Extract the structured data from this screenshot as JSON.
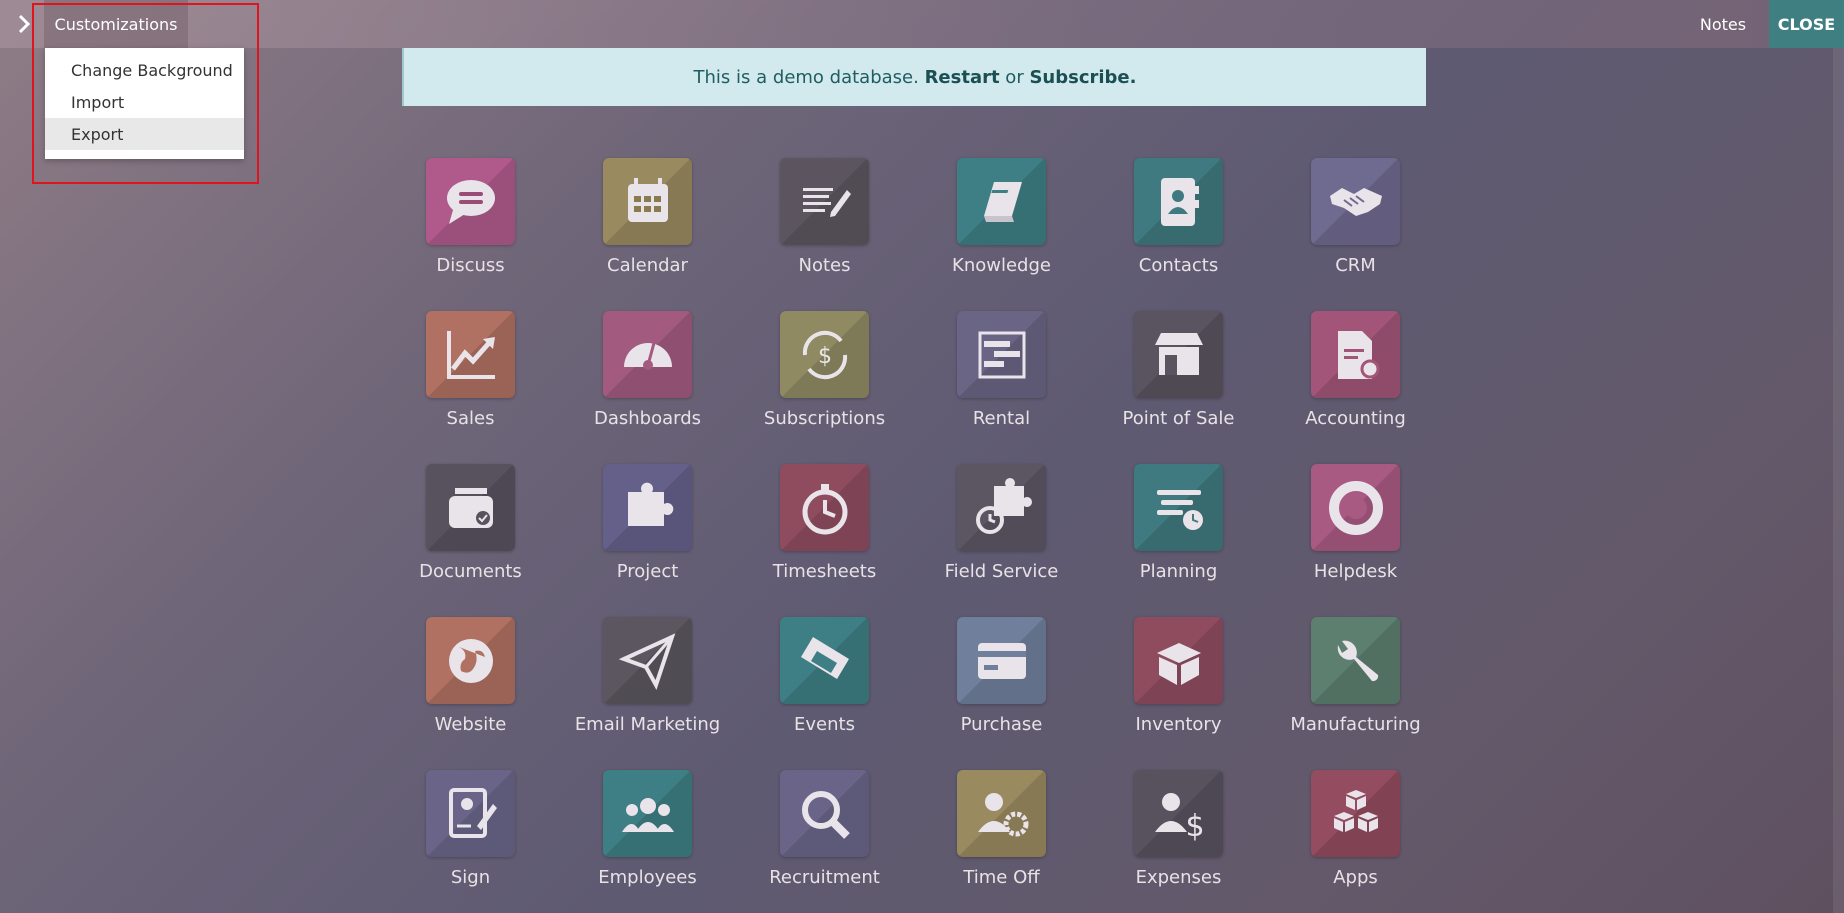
{
  "topbar": {
    "customizations_label": "Customizations",
    "notes_label": "Notes",
    "close_label": "CLOSE"
  },
  "dropdown": {
    "items": [
      {
        "label": "Change Background"
      },
      {
        "label": "Import"
      },
      {
        "label": "Export"
      }
    ]
  },
  "banner": {
    "prefix": "This is a demo database. ",
    "restart": "Restart",
    "middle": " or ",
    "subscribe": "Subscribe."
  },
  "apps": [
    {
      "label": "Discuss",
      "color": "#b05a8c",
      "icon": "chat-bubble-icon"
    },
    {
      "label": "Calendar",
      "color": "#9a8a60",
      "icon": "calendar-icon"
    },
    {
      "label": "Notes",
      "color": "#5c5560",
      "icon": "notes-icon"
    },
    {
      "label": "Knowledge",
      "color": "#3e7f85",
      "icon": "book-icon"
    },
    {
      "label": "Contacts",
      "color": "#3f7a80",
      "icon": "address-book-icon"
    },
    {
      "label": "CRM",
      "color": "#6f6a8f",
      "icon": "handshake-icon"
    },
    {
      "label": "Sales",
      "color": "#b07062",
      "icon": "trend-chart-icon"
    },
    {
      "label": "Dashboards",
      "color": "#a35a7f",
      "icon": "gauge-icon"
    },
    {
      "label": "Subscriptions",
      "color": "#8f8a62",
      "icon": "recurring-dollar-icon"
    },
    {
      "label": "Rental",
      "color": "#6a6585",
      "icon": "gantt-icon"
    },
    {
      "label": "Point of Sale",
      "color": "#5a5360",
      "icon": "shop-icon"
    },
    {
      "label": "Accounting",
      "color": "#a25578",
      "icon": "invoice-gear-icon"
    },
    {
      "label": "Documents",
      "color": "#58525e",
      "icon": "inbox-check-icon"
    },
    {
      "label": "Project",
      "color": "#65608a",
      "icon": "puzzle-icon"
    },
    {
      "label": "Timesheets",
      "color": "#8f4c5f",
      "icon": "stopwatch-icon"
    },
    {
      "label": "Field Service",
      "color": "#5c5663",
      "icon": "puzzle-clock-icon"
    },
    {
      "label": "Planning",
      "color": "#3f7a80",
      "icon": "planning-icon"
    },
    {
      "label": "Helpdesk",
      "color": "#a95a82",
      "icon": "lifebuoy-icon"
    },
    {
      "label": "Website",
      "color": "#b07062",
      "icon": "globe-icon"
    },
    {
      "label": "Email Marketing",
      "color": "#5b5660",
      "icon": "paper-plane-icon"
    },
    {
      "label": "Events",
      "color": "#3e7f85",
      "icon": "ticket-icon"
    },
    {
      "label": "Purchase",
      "color": "#6f7f9c",
      "icon": "credit-card-icon"
    },
    {
      "label": "Inventory",
      "color": "#8f4c5f",
      "icon": "box-icon"
    },
    {
      "label": "Manufacturing",
      "color": "#5d7f70",
      "icon": "wrench-icon"
    },
    {
      "label": "Sign",
      "color": "#6a6588",
      "icon": "signature-icon"
    },
    {
      "label": "Employees",
      "color": "#3e7f85",
      "icon": "team-icon"
    },
    {
      "label": "Recruitment",
      "color": "#6a6588",
      "icon": "magnifier-icon"
    },
    {
      "label": "Time Off",
      "color": "#9a8a60",
      "icon": "user-gear-icon"
    },
    {
      "label": "Expenses",
      "color": "#58525e",
      "icon": "user-dollar-icon"
    },
    {
      "label": "Apps",
      "color": "#934c60",
      "icon": "cubes-icon"
    }
  ]
}
